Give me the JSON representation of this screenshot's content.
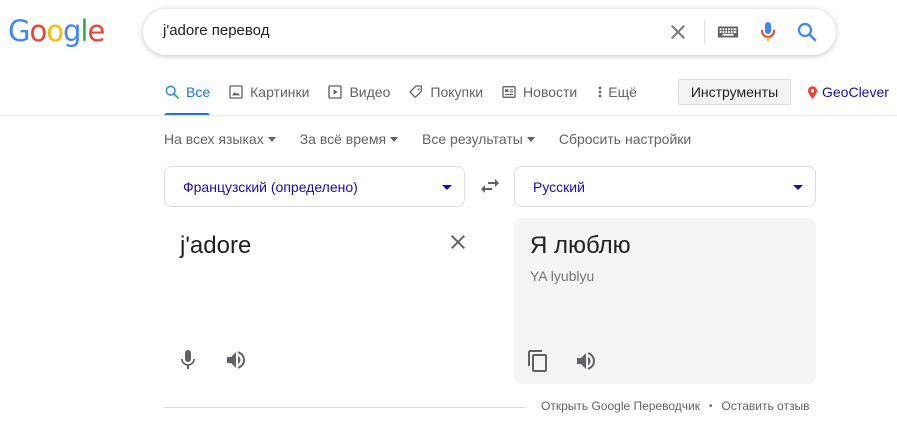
{
  "logo": {
    "letters": [
      "G",
      "o",
      "o",
      "g",
      "l",
      "e"
    ],
    "colors": [
      "#4285f4",
      "#ea4335",
      "#fbbc05",
      "#4285f4",
      "#34a853",
      "#ea4335"
    ]
  },
  "search": {
    "query": "j'adore перевод"
  },
  "tabs": [
    {
      "label": "Все",
      "icon": "search-icon"
    },
    {
      "label": "Картинки",
      "icon": "image-icon"
    },
    {
      "label": "Видео",
      "icon": "video-icon"
    },
    {
      "label": "Покупки",
      "icon": "tag-icon"
    },
    {
      "label": "Новости",
      "icon": "news-icon"
    },
    {
      "label": "Ещё",
      "icon": "more-vert-icon"
    }
  ],
  "tools_label": "Инструменты",
  "geoclever_label": "GeoClever",
  "filters": [
    {
      "label": "На всех языках",
      "has_caret": true
    },
    {
      "label": "За всё время",
      "has_caret": true
    },
    {
      "label": "Все результаты",
      "has_caret": true
    },
    {
      "label": "Сбросить настройки",
      "has_caret": false
    }
  ],
  "translate": {
    "source_lang": "Французский (определено)",
    "target_lang": "Русский",
    "source_text": "j'adore",
    "target_text": "Я люблю",
    "transliteration": "YA lyublyu"
  },
  "footer": {
    "open_link": "Открыть Google Переводчик",
    "feedback_link": "Оставить отзыв"
  },
  "colors": {
    "accent": "#1a73e8",
    "link": "#1a0dab"
  }
}
